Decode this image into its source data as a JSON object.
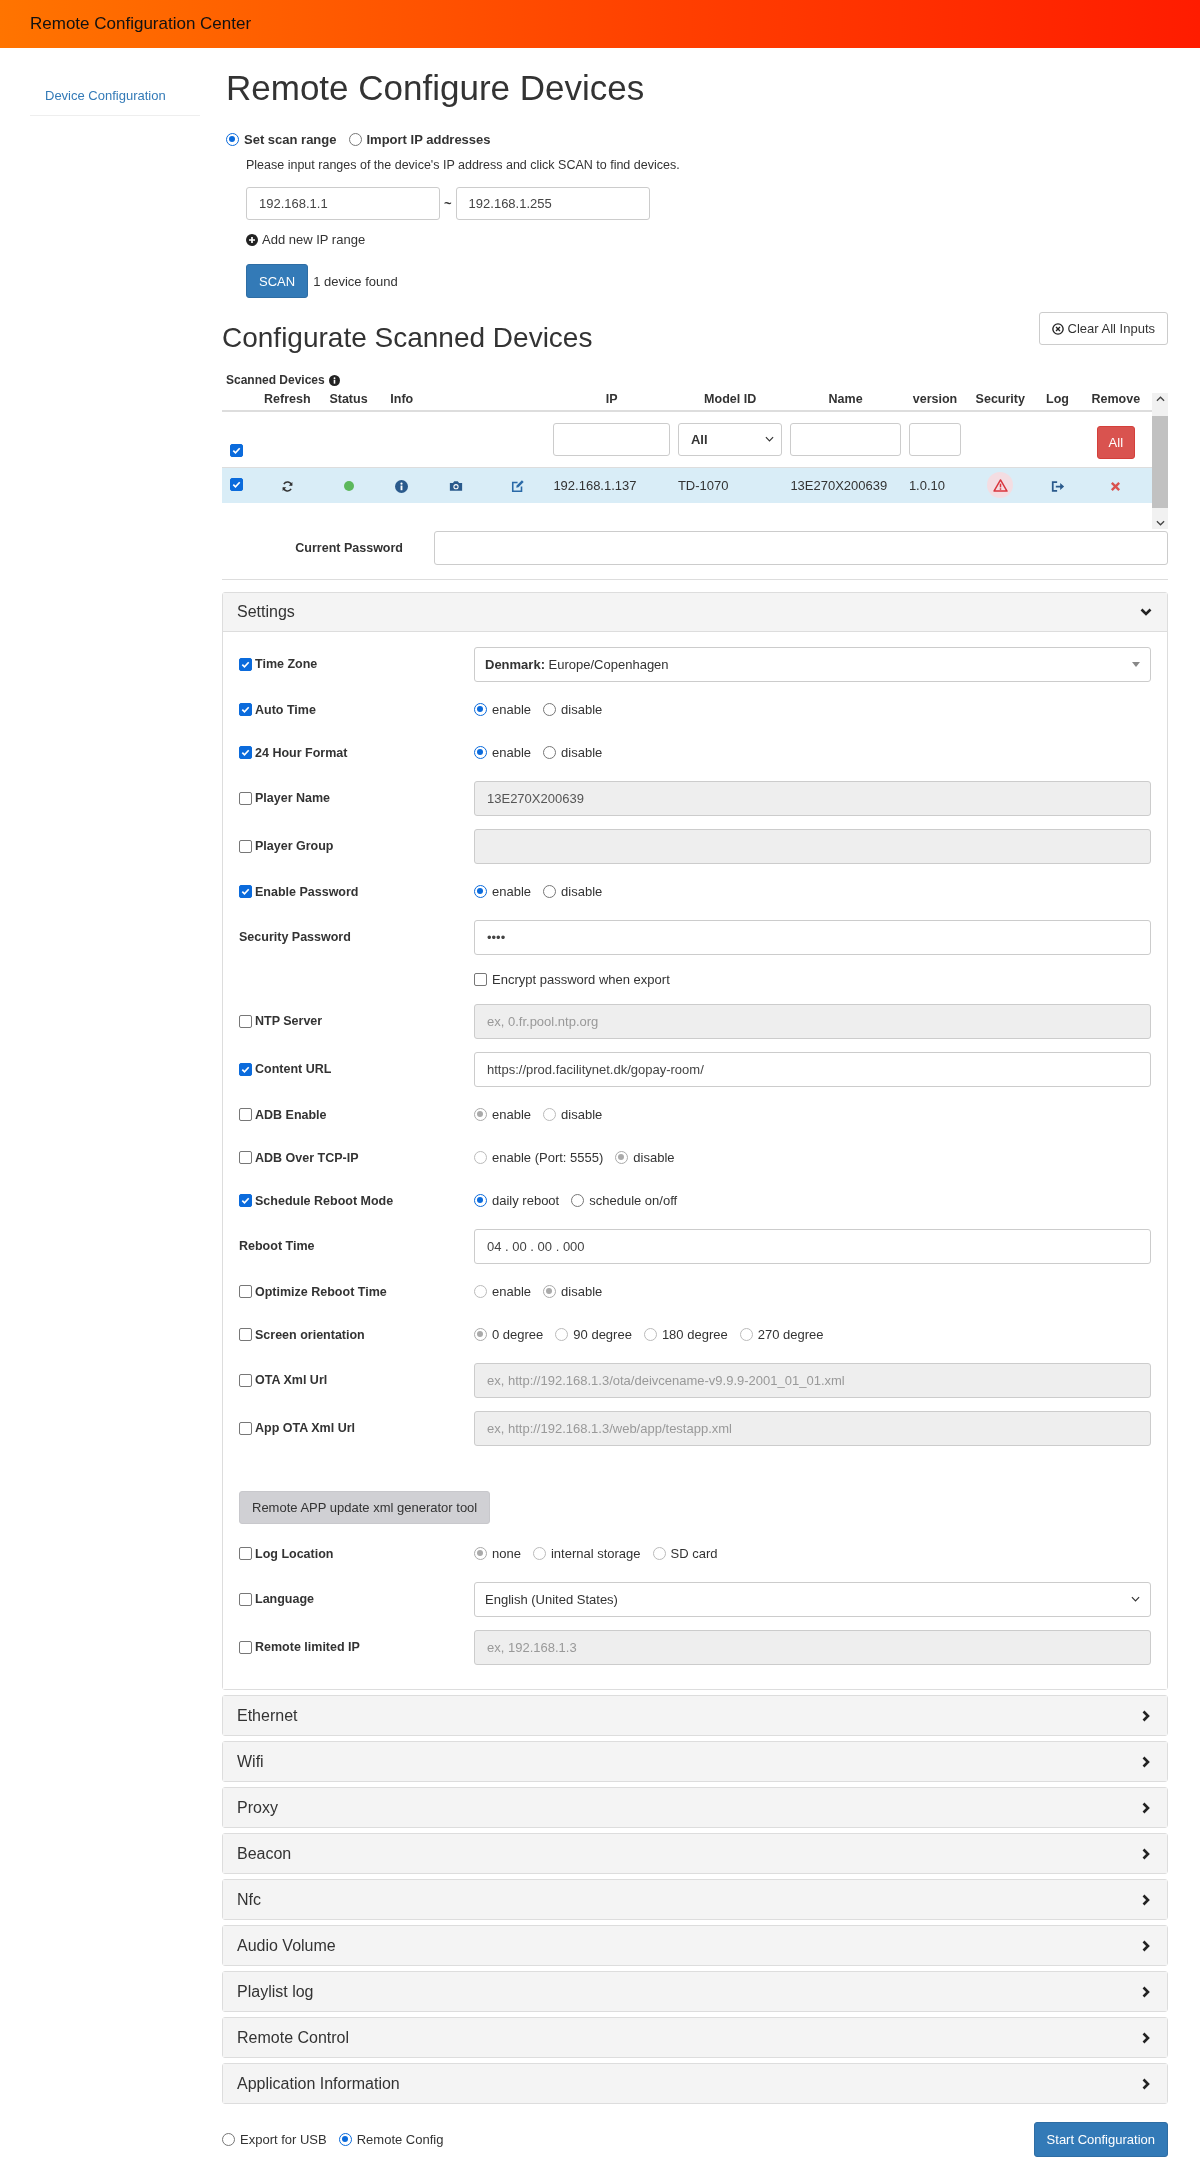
{
  "header": {
    "title": "Remote Configuration Center"
  },
  "sidebar": {
    "items": [
      {
        "label": "Device Configuration"
      }
    ]
  },
  "page_title": "Remote Configure Devices",
  "scan": {
    "modes": [
      {
        "label": "Set scan range",
        "selected": true
      },
      {
        "label": "Import IP addresses",
        "selected": false
      }
    ],
    "instruction": "Please input ranges of the device's IP address and click SCAN to find devices.",
    "range_start": "192.168.1.1",
    "separator": "~",
    "range_end": "192.168.1.255",
    "add_range": "Add new IP range",
    "button": "SCAN",
    "result": "1 device found"
  },
  "devices": {
    "title": "Configurate Scanned Devices",
    "clear_button": "Clear All Inputs",
    "label": "Scanned Devices",
    "columns": [
      "Refresh",
      "Status",
      "Info",
      "IP",
      "Model ID",
      "Name",
      "version",
      "Security",
      "Log",
      "Remove"
    ],
    "filter": {
      "select_all": true,
      "model": "All",
      "remove_all": "All"
    },
    "rows": [
      {
        "checked": true,
        "color": "#5cb85c",
        "ip": "192.168.1.137",
        "model": "TD-1070",
        "name": "13E270X200639",
        "version": "1.0.10"
      }
    ]
  },
  "current_password": {
    "label": "Current Password"
  },
  "sections": [
    {
      "title": "Settings",
      "expanded": true,
      "rows": [
        {
          "kind": "select",
          "label": "Time Zone",
          "checked": true,
          "value": "**Denmark:** Europe/Copenhagen"
        },
        {
          "kind": "radios",
          "label": "Auto Time",
          "checked": true,
          "disabled": false,
          "options": [
            {
              "label": "enable",
              "selected": true
            },
            {
              "label": "disable",
              "selected": false
            }
          ]
        },
        {
          "kind": "radios",
          "label": "24 Hour Format",
          "checked": true,
          "disabled": false,
          "options": [
            {
              "label": "enable",
              "selected": true
            },
            {
              "label": "disable",
              "selected": false
            }
          ]
        },
        {
          "kind": "input",
          "label": "Player Name",
          "checked": false,
          "disabled": true,
          "value": "13E270X200639"
        },
        {
          "kind": "input",
          "label": "Player Group",
          "checked": false,
          "disabled": true
        },
        {
          "kind": "radios",
          "label": "Enable Password",
          "checked": true,
          "disabled": false,
          "options": [
            {
              "label": "enable",
              "selected": true
            },
            {
              "label": "disable",
              "selected": false
            }
          ]
        },
        {
          "kind": "input",
          "label": "Security Password",
          "disabled": false,
          "value": "••••"
        },
        {
          "kind": "option",
          "label": "Encrypt password when export",
          "checked": false
        },
        {
          "kind": "input",
          "label": "NTP Server",
          "checked": false,
          "disabled": true,
          "placeholder": "ex, 0.fr.pool.ntp.org"
        },
        {
          "kind": "input",
          "label": "Content URL",
          "checked": true,
          "disabled": false,
          "value": "https://prod.facilitynet.dk/gopay-room/"
        },
        {
          "kind": "radios",
          "label": "ADB Enable",
          "checked": false,
          "disabled": true,
          "options": [
            {
              "label": "enable",
              "selected": true
            },
            {
              "label": "disable",
              "selected": false
            }
          ]
        },
        {
          "kind": "radios",
          "label": "ADB Over TCP-IP",
          "checked": false,
          "disabled": true,
          "options": [
            {
              "label": "enable (Port: 5555)",
              "selected": false
            },
            {
              "label": "disable",
              "selected": true
            }
          ]
        },
        {
          "kind": "radios",
          "label": "Schedule Reboot Mode",
          "checked": true,
          "disabled": false,
          "options": [
            {
              "label": "daily reboot",
              "selected": true
            },
            {
              "label": "schedule on/off",
              "selected": false
            }
          ]
        },
        {
          "kind": "input",
          "label": "Reboot Time",
          "disabled": false,
          "value": "04 . 00 . 00 . 000"
        },
        {
          "kind": "radios",
          "label": "Optimize Reboot Time",
          "checked": false,
          "disabled": true,
          "options": [
            {
              "label": "enable",
              "selected": false
            },
            {
              "label": "disable",
              "selected": true
            }
          ]
        },
        {
          "kind": "radios",
          "label": "Screen orientation",
          "checked": false,
          "disabled": true,
          "options": [
            {
              "label": "0 degree",
              "selected": true
            },
            {
              "label": "90 degree",
              "selected": false
            },
            {
              "label": "180 degree",
              "selected": false
            },
            {
              "label": "270 degree",
              "selected": false
            }
          ]
        },
        {
          "kind": "input",
          "label": "OTA Xml Url",
          "checked": false,
          "disabled": true,
          "placeholder": "ex, http://192.168.1.3/ota/deivcename-v9.9.9-2001_01_01.xml"
        },
        {
          "kind": "input",
          "label": "App OTA Xml Url",
          "checked": false,
          "disabled": true,
          "placeholder": "ex, http://192.168.1.3/web/app/testapp.xml"
        },
        {
          "kind": "button",
          "label": "Remote APP update xml generator tool"
        },
        {
          "kind": "radios",
          "label": "Log Location",
          "checked": false,
          "disabled": true,
          "options": [
            {
              "label": "none",
              "selected": true
            },
            {
              "label": "internal storage",
              "selected": false
            },
            {
              "label": "SD card",
              "selected": false
            }
          ]
        },
        {
          "kind": "dropdown",
          "label": "Language",
          "checked": false,
          "value": "English (United States)"
        },
        {
          "kind": "input",
          "label": "Remote limited IP",
          "checked": false,
          "disabled": true,
          "placeholder": "ex, 192.168.1.3"
        }
      ]
    },
    {
      "title": "Ethernet",
      "expanded": false
    },
    {
      "title": "Wifi",
      "expanded": false
    },
    {
      "title": "Proxy",
      "expanded": false
    },
    {
      "title": "Beacon",
      "expanded": false
    },
    {
      "title": "Nfc",
      "expanded": false
    },
    {
      "title": "Audio Volume",
      "expanded": false
    },
    {
      "title": "Playlist log",
      "expanded": false
    },
    {
      "title": "Remote Control",
      "expanded": false
    },
    {
      "title": "Application Information",
      "expanded": false
    }
  ],
  "footer": {
    "modes": [
      {
        "label": "Export for USB",
        "selected": false
      },
      {
        "label": "Remote Config",
        "selected": true
      }
    ],
    "button": "Start Configuration"
  }
}
